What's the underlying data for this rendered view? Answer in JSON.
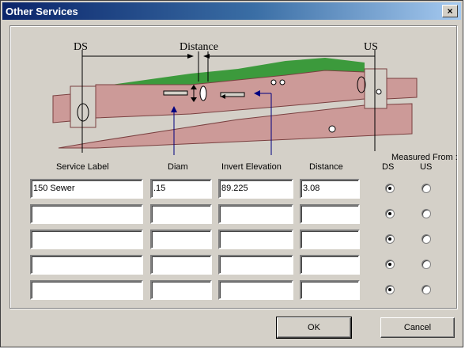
{
  "window": {
    "title": "Other Services",
    "close_glyph": "×"
  },
  "diagram": {
    "ds_label": "DS",
    "distance_label": "Distance",
    "us_label": "US"
  },
  "table": {
    "headers": {
      "service_label": "Service Label",
      "diam": "Diam",
      "invert_elevation": "Invert Elevation",
      "distance": "Distance"
    },
    "measured_from": "Measured From :",
    "ds": "DS",
    "us": "US",
    "rows": [
      {
        "service_label": "150 Sewer",
        "diam": ".15",
        "invert_elevation": "89.225",
        "distance": "3.08",
        "measured_from": "DS"
      },
      {
        "service_label": "",
        "diam": "",
        "invert_elevation": "",
        "distance": "",
        "measured_from": "DS"
      },
      {
        "service_label": "",
        "diam": "",
        "invert_elevation": "",
        "distance": "",
        "measured_from": "DS"
      },
      {
        "service_label": "",
        "diam": "",
        "invert_elevation": "",
        "distance": "",
        "measured_from": "DS"
      },
      {
        "service_label": "",
        "diam": "",
        "invert_elevation": "",
        "distance": "",
        "measured_from": "DS"
      }
    ]
  },
  "buttons": {
    "ok": "OK",
    "cancel": "Cancel"
  },
  "colors": {
    "ground": "#cc9a98",
    "grass": "#3c9a3c",
    "arrow": "#000080",
    "title_start": "#0a246a",
    "title_end": "#a6caf0"
  }
}
